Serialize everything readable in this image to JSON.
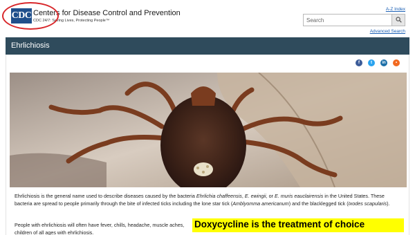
{
  "header": {
    "logo_text": "CDC",
    "org_name": "Centers for Disease Control and Prevention",
    "tagline": "CDC 24/7: Saving Lives, Protecting People™",
    "az_index": "A-Z Index",
    "search_placeholder": "Search",
    "advanced_search": "Advanced Search"
  },
  "page": {
    "title": "Ehrlichiosis"
  },
  "social": [
    "facebook-icon",
    "twitter-icon",
    "linkedin-icon",
    "rss-icon"
  ],
  "body": {
    "para1_a": "Ehrlichiosis is the general name used to describe diseases caused by the bacteria ",
    "para1_sp1": "Ehrlichia chaffeensis",
    "para1_b": ", ",
    "para1_sp2": "E. ewingii",
    "para1_c": ", or ",
    "para1_sp3": "E. muris eauclairensis",
    "para1_d": " in the United States. These bacteria are spread to people primarily through the bite of infected ticks including the lone star tick (",
    "para1_sp4": "Amblyomma americanum",
    "para1_e": ") and the blacklegged tick (",
    "para1_sp5": "Ixodes scapularis",
    "para1_f": ").",
    "para2_a": "People with ehrlichiosis will often have fever, chills, headache, muscle aches,",
    "para2_b": "children of all ages with ehrlichiosis."
  },
  "overlay": {
    "highlight_text": "Doxycycline is the treatment of choice"
  },
  "colors": {
    "title_bar": "#2f4b5c",
    "cdc_blue": "#1f4f8b",
    "annotation_red": "#d8262a",
    "highlight": "#ffff00"
  }
}
